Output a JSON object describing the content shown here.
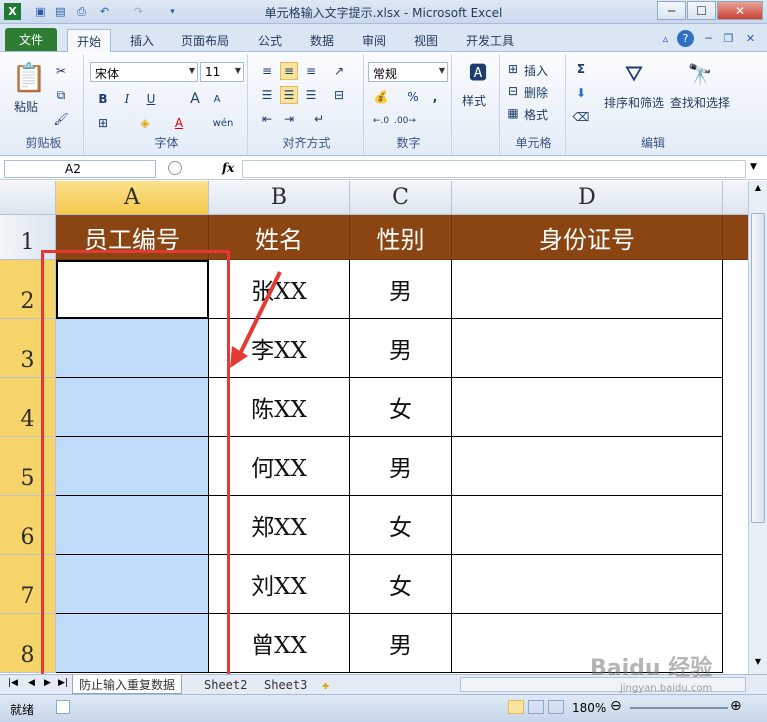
{
  "window": {
    "title": "单元格输入文字提示.xlsx  -  Microsoft Excel",
    "app_icon": "X"
  },
  "tabs": [
    {
      "label": "文件"
    },
    {
      "label": "开始"
    },
    {
      "label": "插入"
    },
    {
      "label": "页面布局"
    },
    {
      "label": "公式"
    },
    {
      "label": "数据"
    },
    {
      "label": "审阅"
    },
    {
      "label": "视图"
    },
    {
      "label": "开发工具"
    }
  ],
  "ribbon": {
    "clipboard": {
      "label": "剪贴板",
      "paste": "粘贴"
    },
    "font": {
      "label": "字体",
      "name": "宋体",
      "size": "11",
      "bold": "B",
      "italic": "I",
      "underline": "U",
      "grow": "A",
      "shrink": "A",
      "color_glyph": "A",
      "phonetic": "wén"
    },
    "alignment": {
      "label": "对齐方式"
    },
    "number": {
      "label": "数字",
      "format": "常规",
      "percent": "%",
      "comma": ","
    },
    "styles": {
      "label": "样式"
    },
    "cells": {
      "label": "单元格",
      "insert": "插入",
      "delete": "删除",
      "format": "格式"
    },
    "editing": {
      "label": "编辑",
      "sigma": "Σ",
      "sort": "排序和筛选",
      "find": "查找和选择"
    }
  },
  "formula_bar": {
    "name_box": "A2",
    "fx": "fx",
    "value": ""
  },
  "columns": [
    "A",
    "B",
    "C",
    "D"
  ],
  "rows": [
    "1",
    "2",
    "3",
    "4",
    "5",
    "6",
    "7",
    "8"
  ],
  "table": {
    "headers": [
      "员工编号",
      "姓名",
      "性别",
      "身份证号"
    ],
    "data": [
      [
        "",
        "张XX",
        "男",
        ""
      ],
      [
        "",
        "李XX",
        "男",
        ""
      ],
      [
        "",
        "陈XX",
        "女",
        ""
      ],
      [
        "",
        "何XX",
        "男",
        ""
      ],
      [
        "",
        "郑XX",
        "女",
        ""
      ],
      [
        "",
        "刘XX",
        "女",
        ""
      ],
      [
        "",
        "曾XX",
        "男",
        ""
      ]
    ]
  },
  "sheets": [
    {
      "label": "防止输入重复数据"
    },
    {
      "label": "Sheet2"
    },
    {
      "label": "Sheet3"
    }
  ],
  "status": {
    "ready": "就绪",
    "zoom": "180%",
    "watermark": "Baidu 经验",
    "watermark_url": "jingyan.baidu.com"
  },
  "colors": {
    "header_bg": "#8b4513",
    "selected_fill": "#bfdcfa",
    "annotation": "#e53935"
  }
}
